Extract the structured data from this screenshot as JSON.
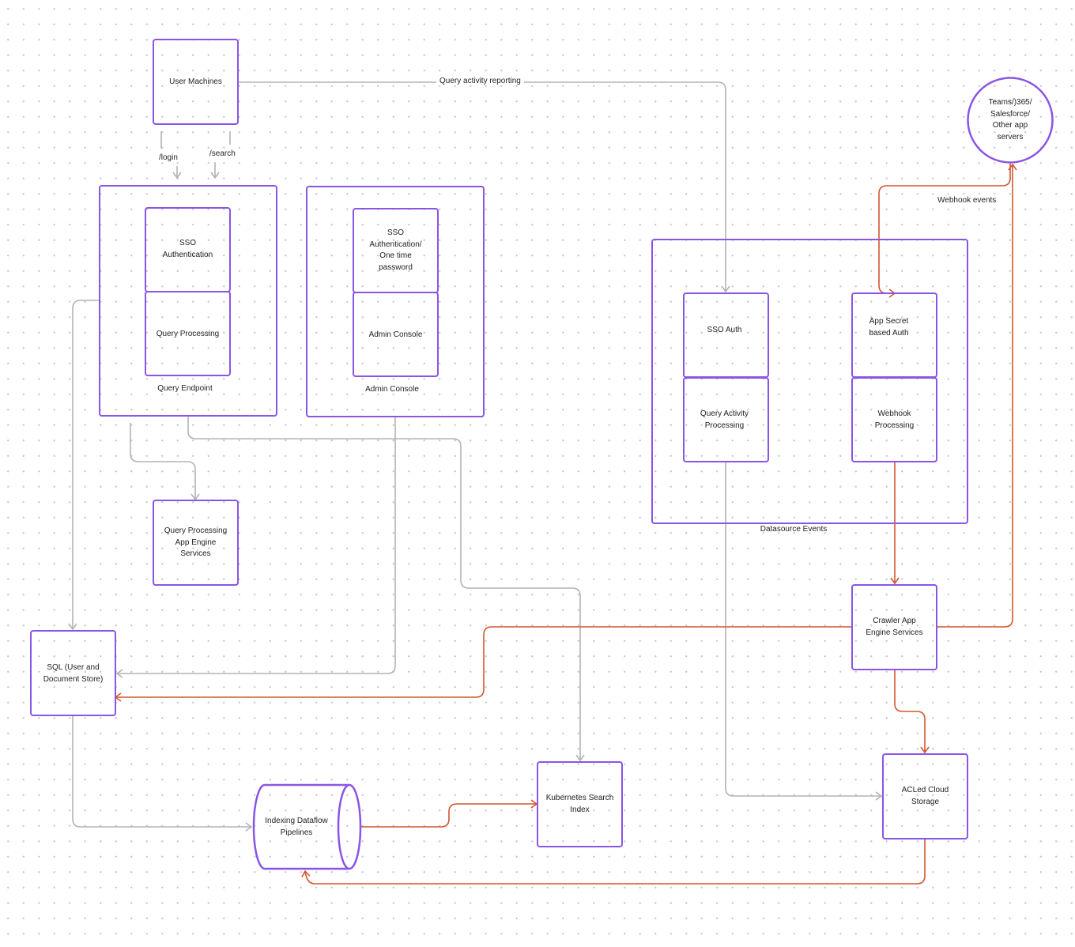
{
  "diagram": {
    "colors": {
      "node_border": "#8a55e6",
      "edge_gray": "#b3b3b3",
      "edge_orange": "#d2572f",
      "text": "#222222"
    },
    "nodes": {
      "user_machines": "User Machines",
      "query_endpoint_group": "Query Endpoint",
      "qe_sso_auth": "SSO\nAuthentication",
      "qe_query_processing": "Query Processing",
      "admin_console_group": "Admin Console",
      "ac_sso_auth": "SSO\nAuthentication/\nOne time\npassword",
      "ac_admin_console": "Admin Console",
      "query_app_engine": "Query Processing\nApp Engine\nServices",
      "datasource_events_group": "Datasource Events",
      "ds_sso_auth": "SSO Auth",
      "ds_query_activity": "Query Activity\nProcessing",
      "ds_app_secret_auth": "App Secret\nbased Auth",
      "ds_webhook_processing": "Webhook\nProcessing",
      "external_servers": "Teams/)365/\nSalesforce/\nOther app\nservers",
      "sql_store": "SQL (User and\nDocument Store)",
      "crawler_app_engine": "Crawler App\nEngine Services",
      "kubernetes_index": "Kubernetes Search\nIndex",
      "indexing_pipelines": "Indexing Dataflow\nPipelines",
      "cloud_storage": "ACLed Cloud\nStorage"
    },
    "edge_labels": {
      "login": "/login",
      "search": "/search",
      "query_activity_reporting": "Query activity reporting",
      "webhook_events": "Webhook events"
    }
  }
}
